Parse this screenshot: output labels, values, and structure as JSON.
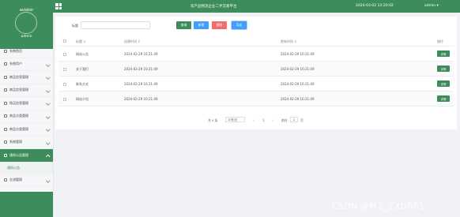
{
  "sidebar": {
    "title": "aviator",
    "username": "admin",
    "items": [
      {
        "label": "系统首页"
      },
      {
        "label": "系统用户"
      },
      {
        "label": "商品信息管理"
      },
      {
        "label": "商品信息管理"
      },
      {
        "label": "购买信息管理"
      },
      {
        "label": "商品分类管理"
      },
      {
        "label": "商品分类管理"
      },
      {
        "label": "系统管理"
      },
      {
        "label": "通知公告管理"
      },
      {
        "label": "交流管理"
      }
    ],
    "subitem": "通知公告"
  },
  "topbar": {
    "title": "农产品物流企业二手交易平台",
    "time": "2024-03-02 13:20:02",
    "user": "admin ▾"
  },
  "search": {
    "label": "标题",
    "placeholder": "",
    "buttons": {
      "query": "查询",
      "add": "新增",
      "delete": "删除",
      "export": "导出"
    }
  },
  "table": {
    "headers": [
      "标题 ↕",
      "创建时间 ↕",
      "更新时间 ↕",
      "操作"
    ],
    "rows": [
      {
        "title": "网站公告",
        "created": "2024-02-29 16:21:49",
        "updated": "2024-02-29 16:21:49",
        "action": "详情"
      },
      {
        "title": "关于我们",
        "created": "2024-02-29 16:21:49",
        "updated": "2024-02-29 16:21:49",
        "action": "详情"
      },
      {
        "title": "联系方式",
        "created": "2024-02-29 16:21:49",
        "updated": "2024-02-29 16:21:49",
        "action": "详情"
      },
      {
        "title": "网站介绍",
        "created": "2024-02-29 16:21:49",
        "updated": "2024-02-29 16:21:49",
        "action": "详情"
      }
    ]
  },
  "pagination": {
    "total": "共 4 条",
    "size": "10条/页",
    "prev": "‹",
    "page": "1",
    "next": "›",
    "goto": "前往",
    "goto_value": "1",
    "page_suffix": "页"
  },
  "watermark": "CSDN @MZ_ZXD001",
  "colors": {
    "primary": "#3d8c5b",
    "add": "#409eff",
    "delete": "#f56c6c"
  },
  "icons": {
    "topbar": "grid-icon",
    "menu": "document-icon"
  }
}
